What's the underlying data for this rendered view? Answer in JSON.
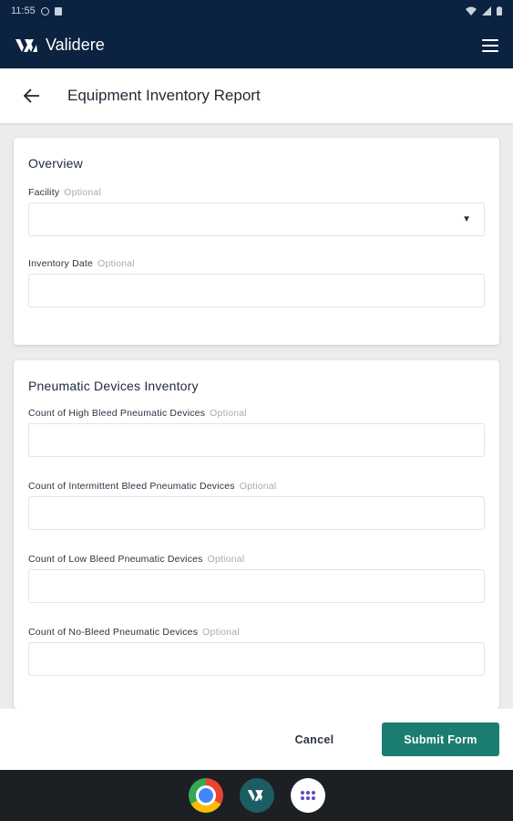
{
  "status_bar": {
    "time": "11:55"
  },
  "app_bar": {
    "brand_name": "Validere"
  },
  "title_bar": {
    "title": "Equipment Inventory Report"
  },
  "overview": {
    "title": "Overview",
    "facility": {
      "label": "Facility",
      "optional": "Optional",
      "value": ""
    },
    "inventory_date": {
      "label": "Inventory Date",
      "optional": "Optional",
      "value": ""
    }
  },
  "pneumatic": {
    "title": "Pneumatic Devices Inventory",
    "fields": [
      {
        "label": "Count of High Bleed Pneumatic Devices",
        "optional": "Optional",
        "value": ""
      },
      {
        "label": "Count of Intermittent Bleed Pneumatic Devices",
        "optional": "Optional",
        "value": ""
      },
      {
        "label": "Count of Low Bleed Pneumatic Devices",
        "optional": "Optional",
        "value": ""
      },
      {
        "label": "Count of No-Bleed Pneumatic Devices",
        "optional": "Optional",
        "value": ""
      }
    ]
  },
  "actions": {
    "cancel": "Cancel",
    "submit": "Submit Form"
  },
  "colors": {
    "header": "#0b2340",
    "accent": "#1b7d72",
    "nav": "#1c1f24"
  },
  "icons": [
    "do-not-disturb-icon",
    "clipboard-icon",
    "wifi-icon",
    "signal-icon",
    "battery-icon",
    "validere-logo-icon",
    "menu-icon",
    "back-arrow-icon",
    "dropdown-caret-icon",
    "chrome-icon",
    "validere-app-icon",
    "app-drawer-icon"
  ]
}
